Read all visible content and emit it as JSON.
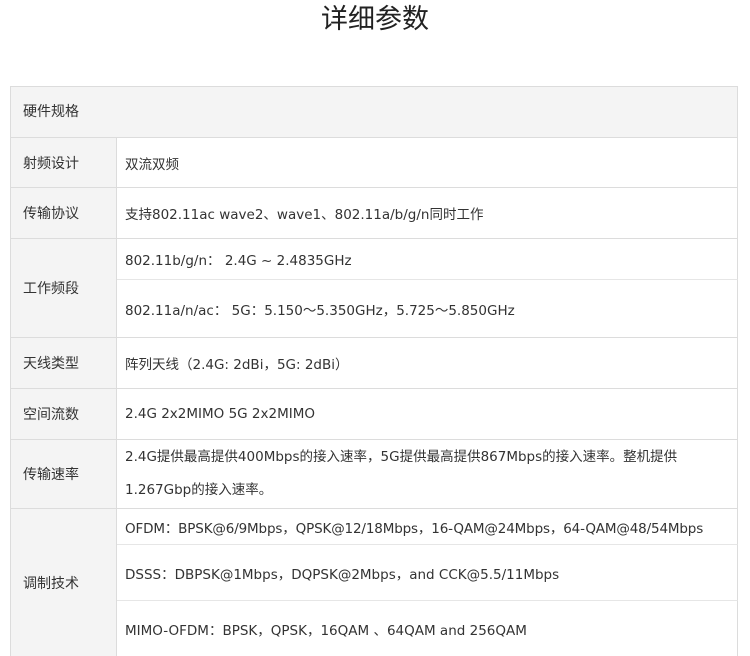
{
  "page": {
    "title": "详细参数"
  },
  "table": {
    "section_header": "硬件规格",
    "rows": [
      {
        "label": "射频设计",
        "values": [
          "双流双频"
        ]
      },
      {
        "label": "传输协议",
        "values": [
          "支持802.11ac wave2、wave1、802.11a/b/g/n同时工作"
        ]
      },
      {
        "label": "工作频段",
        "values": [
          "802.11b/g/n： 2.4G ~ 2.4835GHz",
          "802.11a/n/ac： 5G：5.150～5.350GHz，5.725～5.850GHz"
        ]
      },
      {
        "label": "天线类型",
        "values": [
          "阵列天线（2.4G: 2dBi，5G: 2dBi）"
        ]
      },
      {
        "label": "空间流数",
        "values": [
          "2.4G 2x2MIMO  5G 2x2MIMO"
        ]
      },
      {
        "label": "传输速率",
        "values": [
          "2.4G提供最高提供400Mbps的接入速率，5G提供最高提供867Mbps的接入速率。整机提供1.267Gbp的接入速率。"
        ]
      },
      {
        "label": "调制技术",
        "values": [
          "OFDM：BPSK@6/9Mbps，QPSK@12/18Mbps，16-QAM@24Mbps，64-QAM@48/54Mbps",
          "DSSS：DBPSK@1Mbps，DQPSK@2Mbps，and CCK@5.5/11Mbps",
          "MIMO-OFDM：BPSK，QPSK，16QAM 、64QAM and 256QAM"
        ]
      }
    ]
  }
}
